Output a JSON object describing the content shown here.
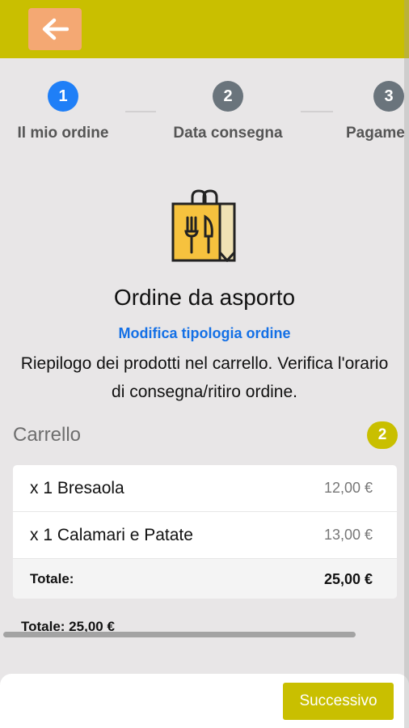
{
  "header": {
    "back_icon": "arrow-left-icon",
    "bar_color": "#c9bf00",
    "back_button_color": "#f4a873"
  },
  "steps": [
    {
      "number": "1",
      "label": "Il mio ordine",
      "active": true,
      "color": "#1f7ff7"
    },
    {
      "number": "2",
      "label": "Data consegna",
      "active": false,
      "color": "#6a747c"
    },
    {
      "number": "3",
      "label": "Pagame",
      "active": false,
      "color": "#6a747c"
    }
  ],
  "order": {
    "icon": "takeaway-bag-icon",
    "title": "Ordine da asporto",
    "change_link": "Modifica tipologia ordine",
    "description": "Riepilogo dei prodotti nel carrello. Verifica l'orario di consegna/ritiro ordine."
  },
  "cart": {
    "title": "Carrello",
    "count": "2",
    "items": [
      {
        "name": "x 1 Bresaola",
        "price": "12,00 €"
      },
      {
        "name": "x 1 Calamari e Patate",
        "price": "13,00 €"
      }
    ],
    "total_label": "Totale:",
    "total_value": "25,00 €"
  },
  "footer": {
    "total_text": "Totale: 25,00 €",
    "next_label": "Successivo",
    "accent": "#c9bf00"
  }
}
